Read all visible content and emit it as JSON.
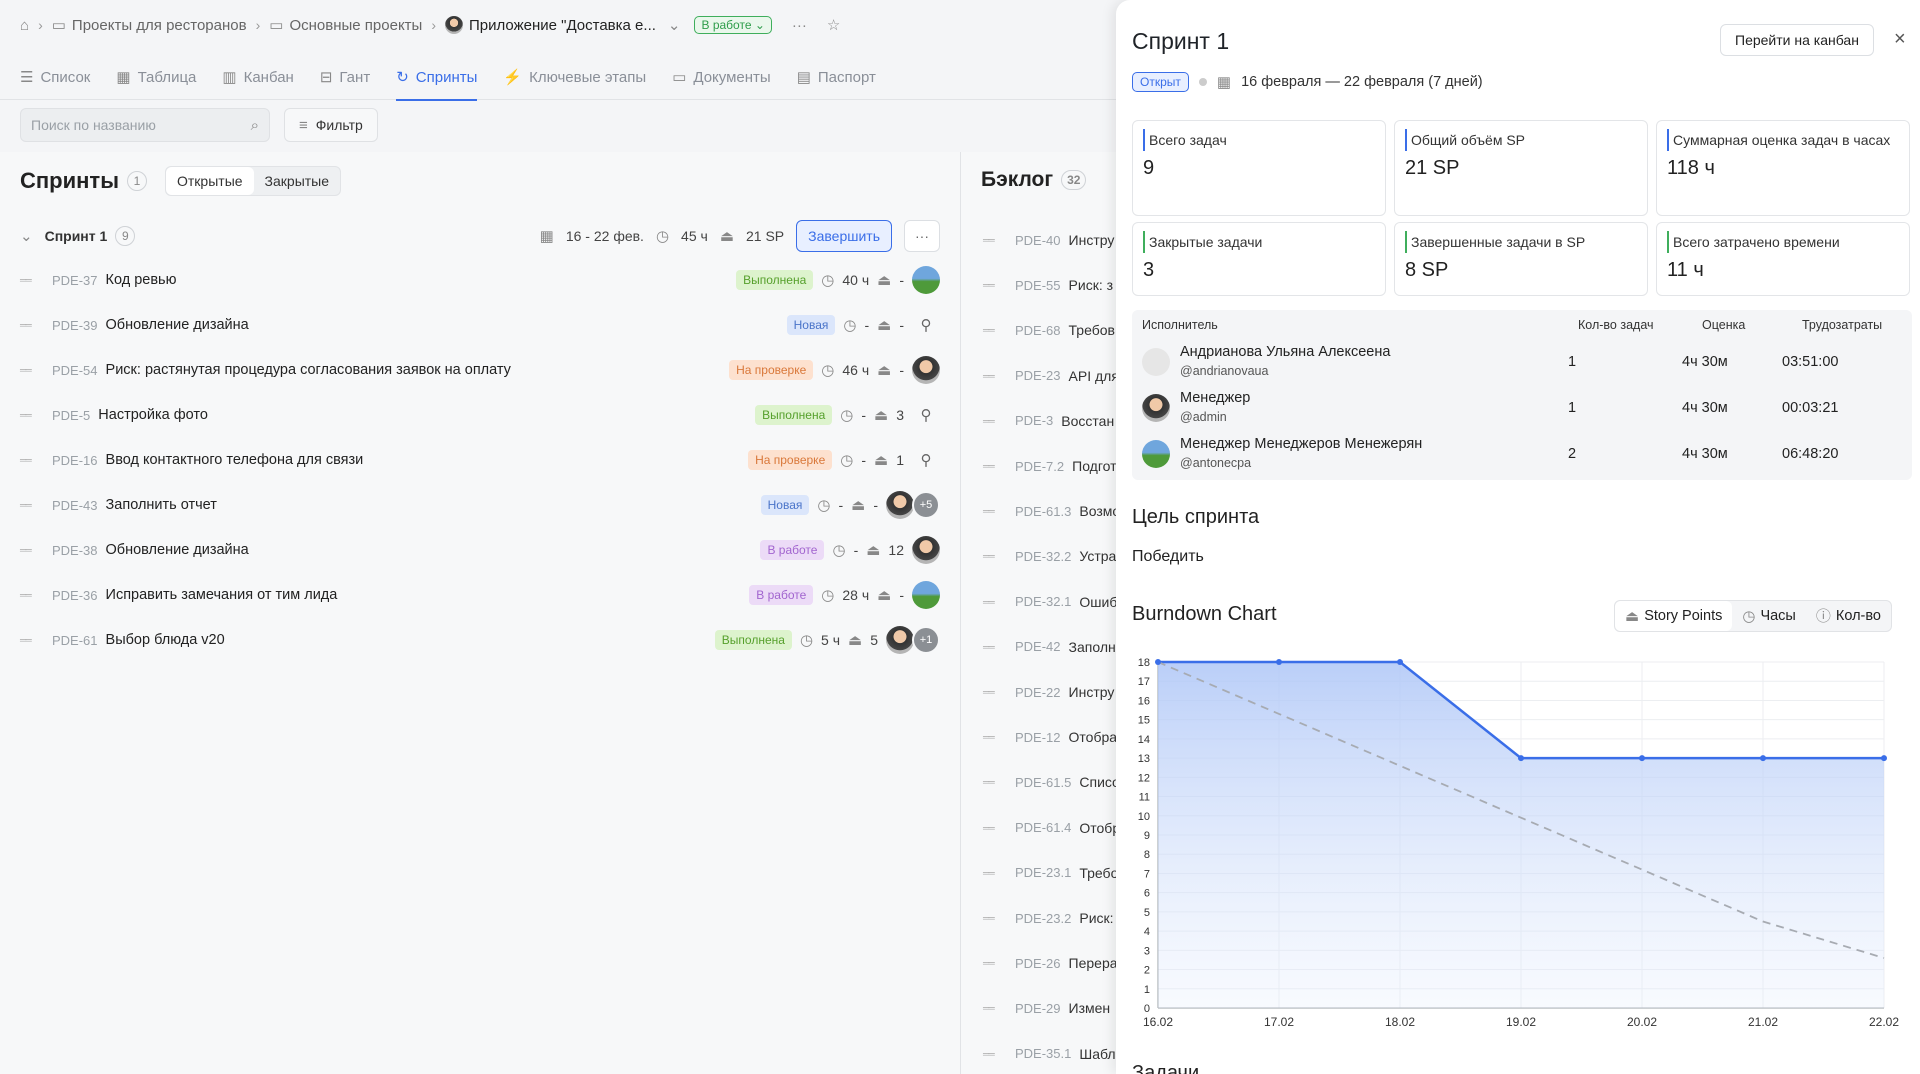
{
  "breadcrumbs": [
    "Проекты для ресторанов",
    "Основные проекты",
    "Приложение \"Доставка е..."
  ],
  "project_status": "В работе",
  "tabs": [
    "Список",
    "Таблица",
    "Канбан",
    "Гант",
    "Спринты",
    "Ключевые этапы",
    "Документы",
    "Паспорт"
  ],
  "search_placeholder": "Поиск по названию",
  "filter_label": "Фильтр",
  "sprints": {
    "title": "Спринты",
    "count": "1",
    "seg_open": "Открытые",
    "seg_closed": "Закрытые",
    "sprint_name": "Спринт 1",
    "sprint_count": "9",
    "dates": "16 - 22 фев.",
    "hours": "45 ч",
    "sp": "21 SP",
    "finish_label": "Завершить"
  },
  "tasks": [
    {
      "key": "PDE-37",
      "title": "Код ревью",
      "status": "Выполнена",
      "st": "done",
      "est": "40 ч",
      "sp": "-",
      "av": "land"
    },
    {
      "key": "PDE-39",
      "title": "Обновление дизайна",
      "status": "Новая",
      "st": "new",
      "est": "-",
      "sp": "-",
      "av": "user"
    },
    {
      "key": "PDE-54",
      "title": "Риск: растянутая процедура согласования заявок на оплату",
      "status": "На проверке",
      "st": "rev",
      "est": "46 ч",
      "sp": "-",
      "av": "man"
    },
    {
      "key": "PDE-5",
      "title": "Настройка фото",
      "status": "Выполнена",
      "st": "done",
      "est": "-",
      "sp": "3",
      "av": "user"
    },
    {
      "key": "PDE-16",
      "title": "Ввод контактного телефона для связи",
      "status": "На проверке",
      "st": "rev",
      "est": "-",
      "sp": "1",
      "av": "user"
    },
    {
      "key": "PDE-43",
      "title": "Заполнить отчет",
      "status": "Новая",
      "st": "new",
      "est": "-",
      "sp": "-",
      "av": "man",
      "plus": "+5"
    },
    {
      "key": "PDE-38",
      "title": "Обновление дизайна",
      "status": "В работе",
      "st": "work",
      "est": "-",
      "sp": "12",
      "av": "man"
    },
    {
      "key": "PDE-36",
      "title": "Исправить замечания от тим лида",
      "status": "В работе",
      "st": "work",
      "est": "28 ч",
      "sp": "-",
      "av": "land"
    },
    {
      "key": "PDE-61",
      "title": "Выбор блюда v20",
      "status": "Выполнена",
      "st": "done",
      "est": "5 ч",
      "sp": "5",
      "av": "man",
      "plus": "+1"
    }
  ],
  "backlog": {
    "title": "Бэклог",
    "count": "32",
    "items": [
      {
        "key": "PDE-40",
        "title": "Инстру"
      },
      {
        "key": "PDE-55",
        "title": "Риск: з"
      },
      {
        "key": "PDE-68",
        "title": "Требов"
      },
      {
        "key": "PDE-23",
        "title": "API для"
      },
      {
        "key": "PDE-3",
        "title": "Восстан"
      },
      {
        "key": "PDE-7.2",
        "title": "Подгот"
      },
      {
        "key": "PDE-61.3",
        "title": "Возмо"
      },
      {
        "key": "PDE-32.2",
        "title": "Устра"
      },
      {
        "key": "PDE-32.1",
        "title": "Ошиб"
      },
      {
        "key": "PDE-42",
        "title": "Заполн"
      },
      {
        "key": "PDE-22",
        "title": "Инстру"
      },
      {
        "key": "PDE-12",
        "title": "Отобра"
      },
      {
        "key": "PDE-61.5",
        "title": "Списо"
      },
      {
        "key": "PDE-61.4",
        "title": "Отобр"
      },
      {
        "key": "PDE-23.1",
        "title": "Требо"
      },
      {
        "key": "PDE-23.2",
        "title": "Риск:"
      },
      {
        "key": "PDE-26",
        "title": "Перера"
      },
      {
        "key": "PDE-29",
        "title": "Измен"
      },
      {
        "key": "PDE-35.1",
        "title": "Шабл"
      }
    ]
  },
  "panel": {
    "title": "Спринт 1",
    "goto_kanban": "Перейти на канбан",
    "status": "Открыт",
    "dates": "16 февраля — 22 февраля (7 дней)",
    "cards": [
      {
        "label": "Всего задач",
        "value": "9",
        "c": "b"
      },
      {
        "label": "Общий объём SP",
        "value": "21 SP",
        "c": "b"
      },
      {
        "label": "Суммарная оценка задач в часах",
        "value": "118 ч",
        "c": "b"
      },
      {
        "label": "Закрытые задачи",
        "value": "3",
        "c": "g"
      },
      {
        "label": "Завершенные задачи в SP",
        "value": "8 SP",
        "c": "g"
      },
      {
        "label": "Всего затрачено времени",
        "value": "11 ч",
        "c": "g"
      }
    ],
    "table_headers": [
      "Исполнитель",
      "Кол-во задач",
      "Оценка",
      "Трудозатраты"
    ],
    "people": [
      {
        "name": "Андрианова Ульяна Алексеена",
        "user": "@andrianovaua",
        "tasks": "1",
        "est": "4ч 30м",
        "spent": "03:51:00",
        "av": "blu"
      },
      {
        "name": "Менеджер",
        "user": "@admin",
        "tasks": "1",
        "est": "4ч 30м",
        "spent": "00:03:21",
        "av": "man"
      },
      {
        "name": "Менеджер Менеджеров Менежерян",
        "user": "@antonecpa",
        "tasks": "2",
        "est": "4ч 30м",
        "spent": "06:48:20",
        "av": "land"
      }
    ],
    "goal_title": "Цель спринта",
    "goal": "Победить",
    "burndown_title": "Burndown Chart",
    "chart_tabs": [
      "Story Points",
      "Часы",
      "Кол-во"
    ],
    "tasks_title": "Задачи"
  },
  "chart_data": {
    "type": "line",
    "x": [
      "16.02",
      "17.02",
      "18.02",
      "19.02",
      "20.02",
      "21.02",
      "22.02"
    ],
    "series": [
      {
        "values": [
          18,
          18,
          18,
          13,
          13,
          13,
          13
        ]
      },
      {
        "values": [
          18,
          15.3,
          12.6,
          9.9,
          7.2,
          4.5,
          2.6
        ]
      }
    ],
    "ylim": [
      0,
      18
    ],
    "accent": "#3a6ee8"
  }
}
